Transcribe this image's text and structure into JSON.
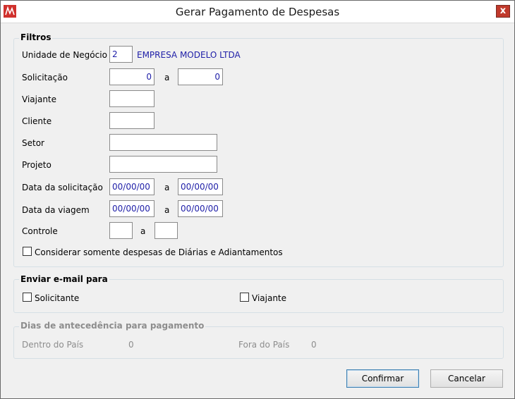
{
  "window": {
    "title": "Gerar Pagamento de Despesas",
    "close_label": "x"
  },
  "filtros": {
    "legend": "Filtros",
    "unidade": {
      "label": "Unidade de Negócio",
      "value": "2",
      "name": "EMPRESA MODELO LTDA"
    },
    "solicitacao": {
      "label": "Solicitação",
      "from": "0",
      "sep": "a",
      "to": "0"
    },
    "viajante": {
      "label": "Viajante",
      "value": ""
    },
    "cliente": {
      "label": "Cliente",
      "value": ""
    },
    "setor": {
      "label": "Setor",
      "value": ""
    },
    "projeto": {
      "label": "Projeto",
      "value": ""
    },
    "data_solicitacao": {
      "label": "Data da solicitação",
      "from": "00/00/00",
      "sep": "a",
      "to": "00/00/00"
    },
    "data_viagem": {
      "label": "Data da viagem",
      "from": "00/00/00",
      "sep": "a",
      "to": "00/00/00"
    },
    "controle": {
      "label": "Controle",
      "from": "",
      "sep": "a",
      "to": ""
    },
    "somente_diarias": {
      "label": "Considerar somente despesas de Diárias e Adiantamentos",
      "checked": false
    }
  },
  "email": {
    "legend": "Enviar e-mail para",
    "solicitante": {
      "label": "Solicitante",
      "checked": false
    },
    "viajante": {
      "label": "Viajante",
      "checked": false
    }
  },
  "dias": {
    "legend": "Dias de antecedência para pagamento",
    "dentro": {
      "label": "Dentro do País",
      "value": "0"
    },
    "fora": {
      "label": "Fora do País",
      "value": "0"
    }
  },
  "buttons": {
    "confirm": "Confirmar",
    "cancel": "Cancelar"
  }
}
